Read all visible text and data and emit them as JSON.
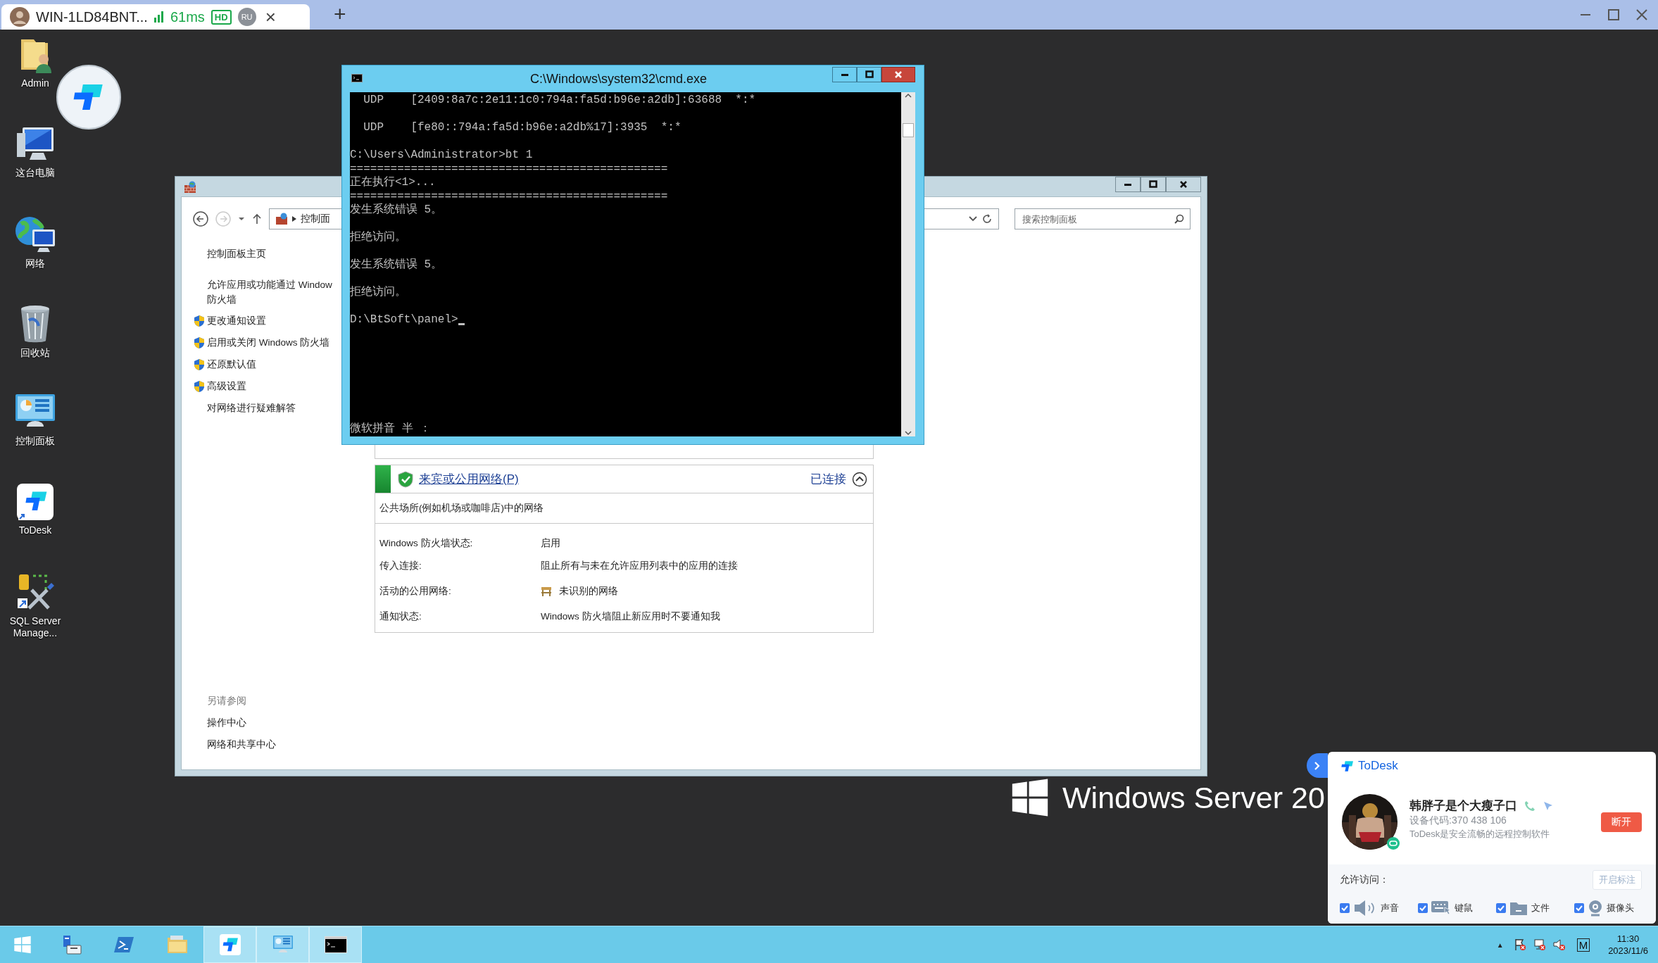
{
  "session_tab": {
    "title": "WIN-1LD84BNT...",
    "latency": "61ms",
    "quality": "HD",
    "user": "RU",
    "close": "×"
  },
  "new_tab": "+",
  "desktop_icons": [
    {
      "label": "Admin",
      "kind": "user-folder"
    },
    {
      "label": "这台电脑",
      "kind": "computer"
    },
    {
      "label": "网络",
      "kind": "network"
    },
    {
      "label": "回收站",
      "kind": "recycle-bin"
    },
    {
      "label": "控制面板",
      "kind": "control-panel"
    },
    {
      "label": "ToDesk",
      "kind": "todesk"
    },
    {
      "label": "SQL Server Manage...",
      "kind": "sql-tools"
    }
  ],
  "control_panel_window": {
    "breadcrumb": "控制面",
    "search": {
      "placeholder": "搜索控制面板"
    },
    "sidebar": {
      "items": [
        {
          "label": "控制面板主页",
          "shield": false
        },
        {
          "label": "允许应用或功能通过 Window\n防火墙",
          "shield": false
        },
        {
          "label": "更改通知设置",
          "shield": true
        },
        {
          "label": "启用或关闭 Windows 防火墙",
          "shield": true
        },
        {
          "label": "还原默认值",
          "shield": true
        },
        {
          "label": "高级设置",
          "shield": true
        },
        {
          "label": "对网络进行疑难解答",
          "shield": false
        }
      ],
      "see_also_title": "另请参阅",
      "see_also": [
        "操作中心",
        "网络和共享中心"
      ]
    },
    "network_panel": {
      "title": "来宾或公用网络(P)",
      "status": "已连接",
      "expanded": true,
      "description": "公共场所(例如机场或咖啡店)中的网络",
      "details": [
        {
          "label": "Windows 防火墙状态:",
          "value": "启用",
          "kind": "text"
        },
        {
          "label": "传入连接:",
          "value": "阻止所有与未在允许应用列表中的应用的连接",
          "kind": "text"
        },
        {
          "label": "活动的公用网络:",
          "value": "未识别的网络",
          "kind": "network"
        },
        {
          "label": "通知状态:",
          "value": "Windows 防火墙阻止新应用时不要通知我",
          "kind": "text"
        }
      ]
    }
  },
  "cmd_window": {
    "title": "C:\\Windows\\system32\\cmd.exe",
    "cursor": true,
    "lines": [
      {
        "text": "  UDP    [2409:8a7c:2e11:1c0:794a:fa5d:b96e:a2db]:63688  *:*",
        "spaced": true
      },
      {
        "text": "  UDP    [fe80::794a:fa5d:b96e:a2db%17]:3935  *:*",
        "spaced": true
      },
      {
        "text": "C:\\Users\\Administrator>bt 1",
        "spaced": false
      },
      {
        "text": "===============================================",
        "spaced": false
      },
      {
        "text": "正在执行<1>...",
        "spaced": false
      },
      {
        "text": "===============================================",
        "spaced": false
      },
      {
        "text": "发生系统错误 5。",
        "spaced": true
      },
      {
        "text": "拒绝访问。",
        "spaced": true
      },
      {
        "text": "发生系统错误 5。",
        "spaced": true
      },
      {
        "text": "拒绝访问。",
        "spaced": true
      },
      {
        "text": "D:\\BtSoft\\panel>",
        "spaced": false
      }
    ],
    "ime_status": "微软拼音 半 ："
  },
  "wallpaper_brand": "Windows Server 20",
  "todesk_panel": {
    "brand": "ToDesk",
    "user_name": "韩胖子是个大瘦子口",
    "device_code": "设备代码:370 438 106",
    "tagline": "ToDesk是安全流畅的远程控制软件",
    "disconnect": "断开",
    "permissions_label": "允许访问：",
    "annotate_button": "开启标注",
    "permissions": [
      {
        "label": "声音",
        "kind": "sound",
        "checked": true
      },
      {
        "label": "键鼠",
        "kind": "keyboard-mouse",
        "checked": true
      },
      {
        "label": "文件",
        "kind": "file",
        "checked": true
      },
      {
        "label": "摄像头",
        "kind": "camera",
        "checked": true
      }
    ]
  },
  "taskbar": {
    "apps": [
      {
        "kind": "start",
        "running": false
      },
      {
        "kind": "server-manager",
        "running": false
      },
      {
        "kind": "powershell",
        "running": false
      },
      {
        "kind": "explorer",
        "running": false
      },
      {
        "kind": "todesk",
        "running": true
      },
      {
        "kind": "control-panel",
        "running": true
      },
      {
        "kind": "cmd",
        "running": true
      }
    ],
    "tray_arrow": "▲",
    "ime": "M",
    "time": "11:30",
    "date": "2023/11/6"
  }
}
